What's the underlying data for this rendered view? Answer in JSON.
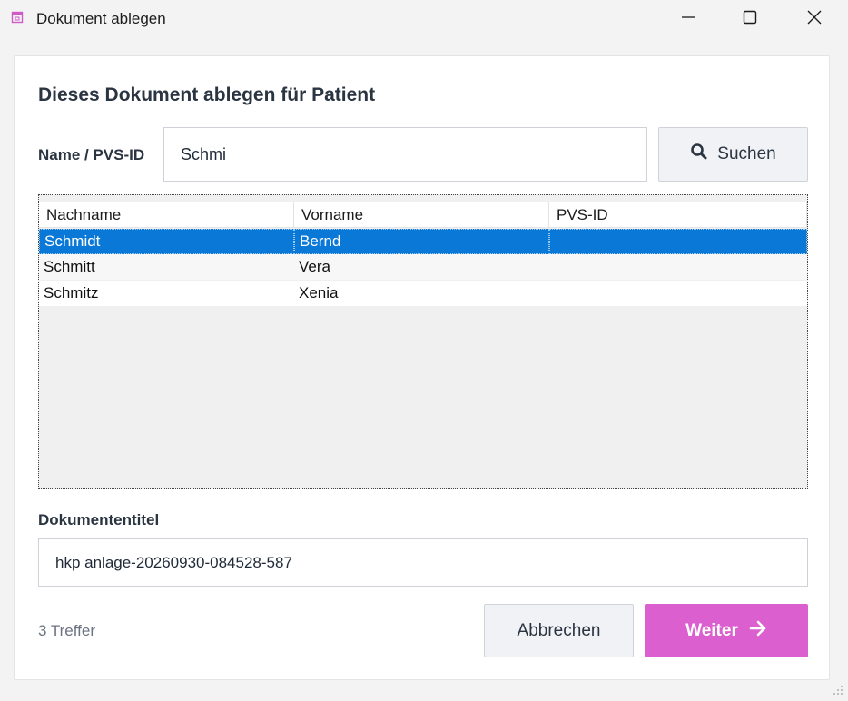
{
  "window": {
    "title": "Dokument ablegen",
    "icon": "app-window-icon",
    "controls": [
      "minimize-icon",
      "maximize-icon",
      "close-icon"
    ]
  },
  "dialog": {
    "heading": "Dieses Dokument ablegen für Patient",
    "search": {
      "label": "Name / PVS-ID",
      "value": "Schmi",
      "button_label": "Suchen",
      "button_icon": "search-icon"
    },
    "table": {
      "columns": [
        "Nachname",
        "Vorname",
        "PVS-ID"
      ],
      "rows": [
        {
          "nachname": "Schmidt",
          "vorname": "Bernd",
          "pvs_id": "",
          "selected": true
        },
        {
          "nachname": "Schmitt",
          "vorname": "Vera",
          "pvs_id": "",
          "selected": false
        },
        {
          "nachname": "Schmitz",
          "vorname": "Xenia",
          "pvs_id": "",
          "selected": false
        }
      ]
    },
    "document_title": {
      "label": "Dokumententitel",
      "value": "hkp anlage-20260930-084528-587"
    },
    "hits": "3 Treffer",
    "cancel_label": "Abbrechen",
    "next_label": "Weiter",
    "next_icon": "arrow-right-icon"
  },
  "colors": {
    "accent": "#db5fcf",
    "selection": "#0a78d7",
    "heading_text": "#2b3441"
  }
}
